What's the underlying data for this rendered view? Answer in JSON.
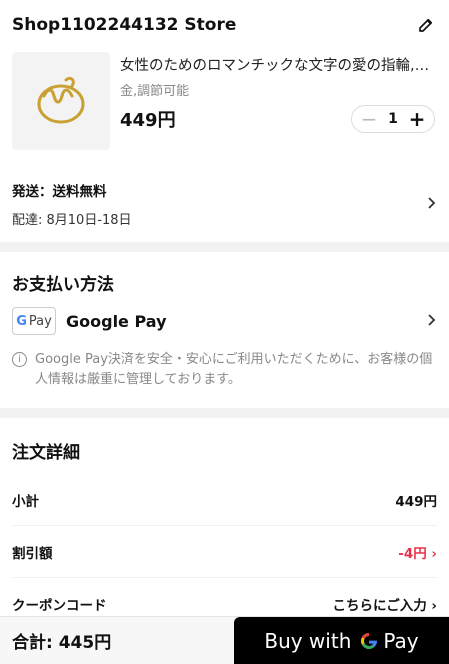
{
  "store": {
    "name": "Shop1102244132 Store"
  },
  "product": {
    "title": "女性のためのロマンチックな文字の愛の指輪,幾何学的なデザイン",
    "variant": "金,調節可能",
    "price": "449円",
    "quantity": "1"
  },
  "shipping": {
    "title": "発送：送料無料",
    "date": "配達: 8月10日-18日"
  },
  "payment": {
    "heading": "お支払い方法",
    "badge_g": "G",
    "badge_text": "Pay",
    "method": "Google Pay",
    "note": "Google Pay決済を安全・安心にご利用いただくために、お客様の個人情報は厳重に管理しております。"
  },
  "order": {
    "heading": "注文詳細",
    "rows": [
      {
        "label": "小計",
        "value": "449円"
      },
      {
        "label": "割引額",
        "value": "-4円"
      },
      {
        "label": "クーポンコード",
        "value": "こちらにご入力"
      }
    ]
  },
  "footer": {
    "total": "合計: 445円",
    "buy_prefix": "Buy with",
    "buy_suffix": "Pay"
  },
  "colors": {
    "discount": "#e8334a",
    "buy_button": "#000000"
  }
}
